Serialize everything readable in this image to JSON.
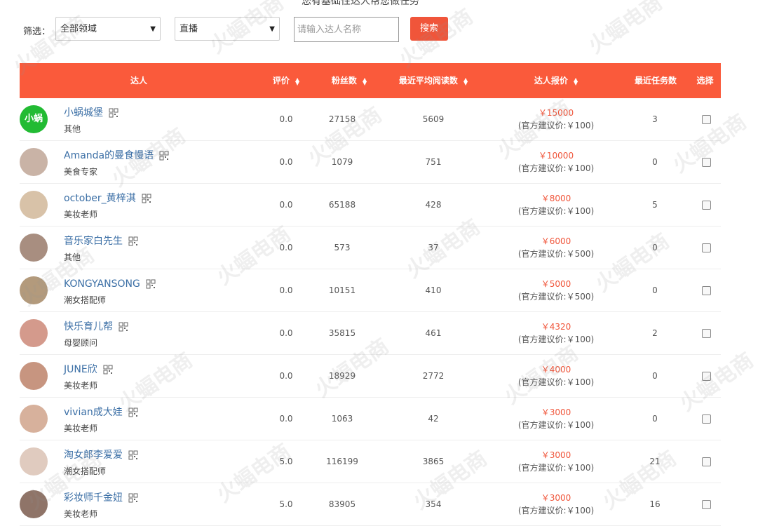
{
  "top_text": "您有基础性达人帮您做任务",
  "filter": {
    "label": "筛选：",
    "domain_value": "全部领域",
    "type_value": "直播",
    "search_placeholder": "请输入达人名称",
    "search_button": "搜索"
  },
  "table": {
    "headers": {
      "influencer": "达人",
      "rating": "评价",
      "fans": "粉丝数",
      "reads": "最近平均阅读数",
      "quote": "达人报价",
      "tasks": "最近任务数",
      "select": "选择"
    },
    "rows": [
      {
        "name": "小蜗城堡",
        "category": "其他",
        "rating": "0.0",
        "fans": "27158",
        "reads": "5609",
        "price": "￥15000",
        "suggest": "(官方建议价:￥100)",
        "tasks": "3",
        "avatar_text": "小蜗"
      },
      {
        "name": "Amanda的曼食慢语",
        "category": "美食专家",
        "rating": "0.0",
        "fans": "1079",
        "reads": "751",
        "price": "￥10000",
        "suggest": "(官方建议价:￥100)",
        "tasks": "0"
      },
      {
        "name": "october_黄梓淇",
        "category": "美妆老师",
        "rating": "0.0",
        "fans": "65188",
        "reads": "428",
        "price": "￥8000",
        "suggest": "(官方建议价:￥100)",
        "tasks": "5"
      },
      {
        "name": "音乐家白先生",
        "category": "其他",
        "rating": "0.0",
        "fans": "573",
        "reads": "37",
        "price": "￥6000",
        "suggest": "(官方建议价:￥500)",
        "tasks": "0"
      },
      {
        "name": "KONGYANSONG",
        "category": "潮女搭配师",
        "rating": "0.0",
        "fans": "10151",
        "reads": "410",
        "price": "￥5000",
        "suggest": "(官方建议价:￥500)",
        "tasks": "0"
      },
      {
        "name": "快乐育儿帮",
        "category": "母婴顾问",
        "rating": "0.0",
        "fans": "35815",
        "reads": "461",
        "price": "￥4320",
        "suggest": "(官方建议价:￥100)",
        "tasks": "2"
      },
      {
        "name": "JUNE欣",
        "category": "美妆老师",
        "rating": "0.0",
        "fans": "18929",
        "reads": "2772",
        "price": "￥4000",
        "suggest": "(官方建议价:￥100)",
        "tasks": "0"
      },
      {
        "name": "vivian成大娃",
        "category": "美妆老师",
        "rating": "0.0",
        "fans": "1063",
        "reads": "42",
        "price": "￥3000",
        "suggest": "(官方建议价:￥100)",
        "tasks": "0"
      },
      {
        "name": "淘女郎李爱爱",
        "category": "潮女搭配师",
        "rating": "5.0",
        "fans": "116199",
        "reads": "3865",
        "price": "￥3000",
        "suggest": "(官方建议价:￥100)",
        "tasks": "21"
      },
      {
        "name": "彩妆师千金妞",
        "category": "美妆老师",
        "rating": "5.0",
        "fans": "83905",
        "reads": "354",
        "price": "￥3000",
        "suggest": "(官方建议价:￥100)",
        "tasks": "16"
      }
    ]
  },
  "watermark": "火蝠电商",
  "colors": {
    "accent": "#fa5a3b",
    "button": "#f0553a",
    "link": "#3a6ea5",
    "price": "#f0553a"
  }
}
